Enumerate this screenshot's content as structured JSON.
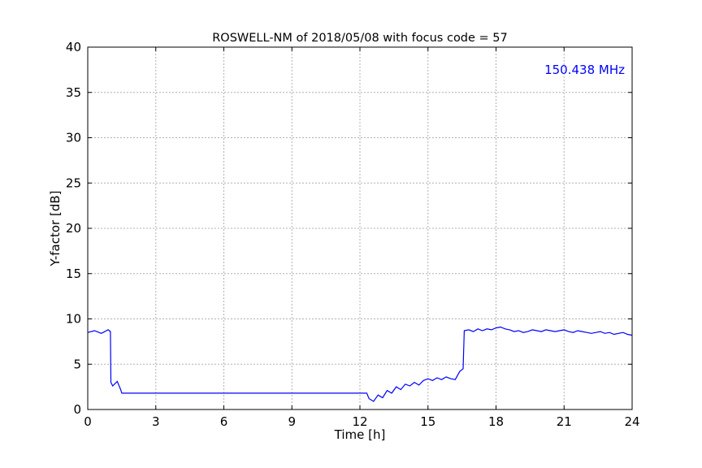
{
  "chart_data": {
    "type": "line",
    "title": "ROSWELL-NM of 2018/05/08 with focus code = 57",
    "xlabel": "Time [h]",
    "ylabel": "Y-factor [dB]",
    "xlim": [
      0,
      24
    ],
    "ylim": [
      0,
      40
    ],
    "xticks": [
      0,
      3,
      6,
      9,
      12,
      15,
      18,
      21,
      24
    ],
    "yticks": [
      0,
      5,
      10,
      15,
      20,
      25,
      30,
      35,
      40
    ],
    "grid": true,
    "annotation": "150.438 MHz",
    "color": "#0000ff",
    "series": [
      {
        "x": [
          0,
          0.3,
          0.6,
          0.9,
          1.0,
          1.02,
          1.1,
          1.3,
          1.45,
          1.5,
          3,
          6,
          9,
          12,
          12.3,
          12.4,
          12.6,
          12.8,
          13.0,
          13.2,
          13.4,
          13.6,
          13.8,
          14.0,
          14.2,
          14.4,
          14.6,
          14.8,
          15.0,
          15.2,
          15.4,
          15.6,
          15.8,
          16.0,
          16.2,
          16.4,
          16.55,
          16.6,
          16.8,
          17.0,
          17.2,
          17.4,
          17.6,
          17.8,
          18.0,
          18.2,
          18.4,
          18.6,
          18.8,
          19.0,
          19.2,
          19.4,
          19.6,
          19.8,
          20.0,
          20.2,
          20.4,
          20.6,
          20.8,
          21.0,
          21.2,
          21.4,
          21.6,
          21.8,
          22.0,
          22.2,
          22.4,
          22.6,
          22.8,
          23.0,
          23.2,
          23.4,
          23.6,
          23.8,
          24.0
        ],
        "y": [
          8.5,
          8.7,
          8.4,
          8.8,
          8.6,
          3.0,
          2.6,
          3.1,
          2.2,
          1.8,
          1.8,
          1.8,
          1.8,
          1.8,
          1.8,
          1.2,
          0.9,
          1.6,
          1.3,
          2.1,
          1.8,
          2.5,
          2.2,
          2.8,
          2.6,
          3.0,
          2.7,
          3.2,
          3.4,
          3.2,
          3.5,
          3.3,
          3.6,
          3.4,
          3.3,
          4.2,
          4.5,
          8.7,
          8.8,
          8.6,
          8.9,
          8.7,
          8.9,
          8.8,
          9.0,
          9.1,
          8.9,
          8.8,
          8.6,
          8.7,
          8.5,
          8.6,
          8.8,
          8.7,
          8.6,
          8.8,
          8.7,
          8.6,
          8.7,
          8.8,
          8.6,
          8.5,
          8.7,
          8.6,
          8.5,
          8.4,
          8.5,
          8.6,
          8.4,
          8.5,
          8.3,
          8.4,
          8.5,
          8.3,
          8.2
        ]
      }
    ]
  }
}
